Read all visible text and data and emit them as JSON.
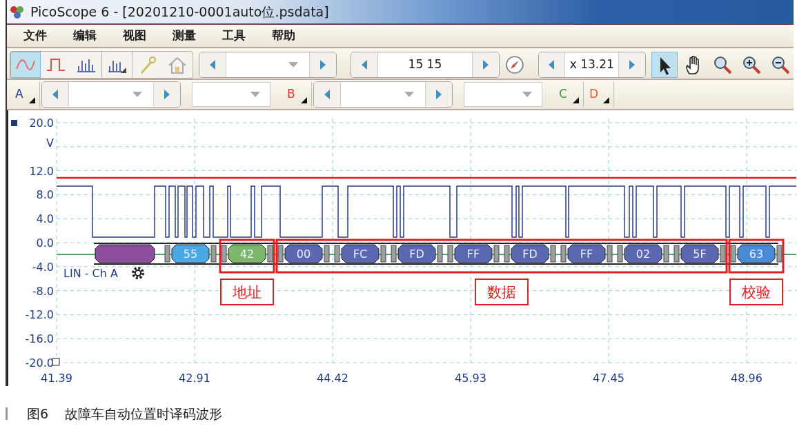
{
  "window": {
    "title": "PicoScope 6 - [20201210-0001auto位.psdata]"
  },
  "menu": [
    "文件",
    "编辑",
    "视图",
    "测量",
    "工具",
    "帮助"
  ],
  "view_buttons": [
    {
      "kind": "scope",
      "selected": true
    },
    {
      "kind": "pulse",
      "selected": false
    },
    {
      "kind": "spectrum",
      "selected": false
    },
    {
      "kind": "spectrum-persistence",
      "selected": false
    },
    {
      "kind": "wand",
      "selected": false
    },
    {
      "kind": "home",
      "selected": false
    }
  ],
  "capture_spinner": {
    "value": "15 15"
  },
  "zoom_spinner": {
    "value": "x 13.21"
  },
  "tools": [
    {
      "kind": "pointer",
      "selected": true
    },
    {
      "kind": "hand",
      "selected": false
    },
    {
      "kind": "zoom-fit",
      "selected": false
    },
    {
      "kind": "zoom-in",
      "selected": false
    },
    {
      "kind": "zoom-out",
      "selected": false
    }
  ],
  "channels": [
    {
      "label": "A",
      "color": "#1c3c96",
      "kind": "full"
    },
    {
      "label": "B",
      "color": "#d83a3a",
      "kind": "full"
    },
    {
      "label": "C",
      "color": "#3a9a3a",
      "kind": "compact"
    },
    {
      "label": "D",
      "color": "#d8603c",
      "kind": "compact"
    }
  ],
  "plot": {
    "y_ticks": [
      {
        "label": "20.0",
        "kind": "value"
      },
      {
        "label": "V",
        "kind": "unit"
      },
      {
        "label": "12.0",
        "kind": "value"
      },
      {
        "label": "8.0",
        "kind": "value"
      },
      {
        "label": "4.0",
        "kind": "value"
      },
      {
        "label": "0.0",
        "kind": "value"
      },
      {
        "label": "-4.0",
        "kind": "value"
      },
      {
        "label": "-8.0",
        "kind": "value"
      },
      {
        "label": "-12.0",
        "kind": "value"
      },
      {
        "label": "-16.0",
        "kind": "value"
      },
      {
        "label": "-20.0",
        "kind": "value"
      }
    ],
    "x_ticks": [
      "41.39",
      "42.91",
      "44.42",
      "45.93",
      "47.45",
      "48.96"
    ],
    "decoder_label": "LIN - Ch A",
    "frames": [
      {
        "packets": [
          {
            "kind": "break",
            "color": "#8c4e9c"
          }
        ]
      },
      {
        "packets": [
          {
            "kind": "byte",
            "label": "55",
            "color": "#4aa8e2"
          }
        ]
      },
      {
        "annotation": "地址",
        "packets": [
          {
            "kind": "byte",
            "label": "42",
            "color": "#7cb86a"
          }
        ]
      },
      {
        "annotation": "数据",
        "packets": [
          {
            "kind": "byte",
            "label": "00",
            "color": "#5a68b2"
          },
          {
            "kind": "byte",
            "label": "FC",
            "color": "#5a68b2"
          },
          {
            "kind": "byte",
            "label": "FD",
            "color": "#5a68b2"
          },
          {
            "kind": "byte",
            "label": "FF",
            "color": "#5a68b2"
          },
          {
            "kind": "byte",
            "label": "FD",
            "color": "#5a68b2"
          },
          {
            "kind": "byte",
            "label": "FF",
            "color": "#5a68b2"
          },
          {
            "kind": "byte",
            "label": "02",
            "color": "#5a68b2"
          },
          {
            "kind": "byte",
            "label": "5F",
            "color": "#5a68b2"
          }
        ]
      },
      {
        "annotation": "校验",
        "packets": [
          {
            "kind": "byte",
            "label": "63",
            "color": "#4a8ad4"
          }
        ]
      }
    ]
  },
  "caption": {
    "figure": "图6",
    "text": "故障车自动位置时译码波形"
  }
}
